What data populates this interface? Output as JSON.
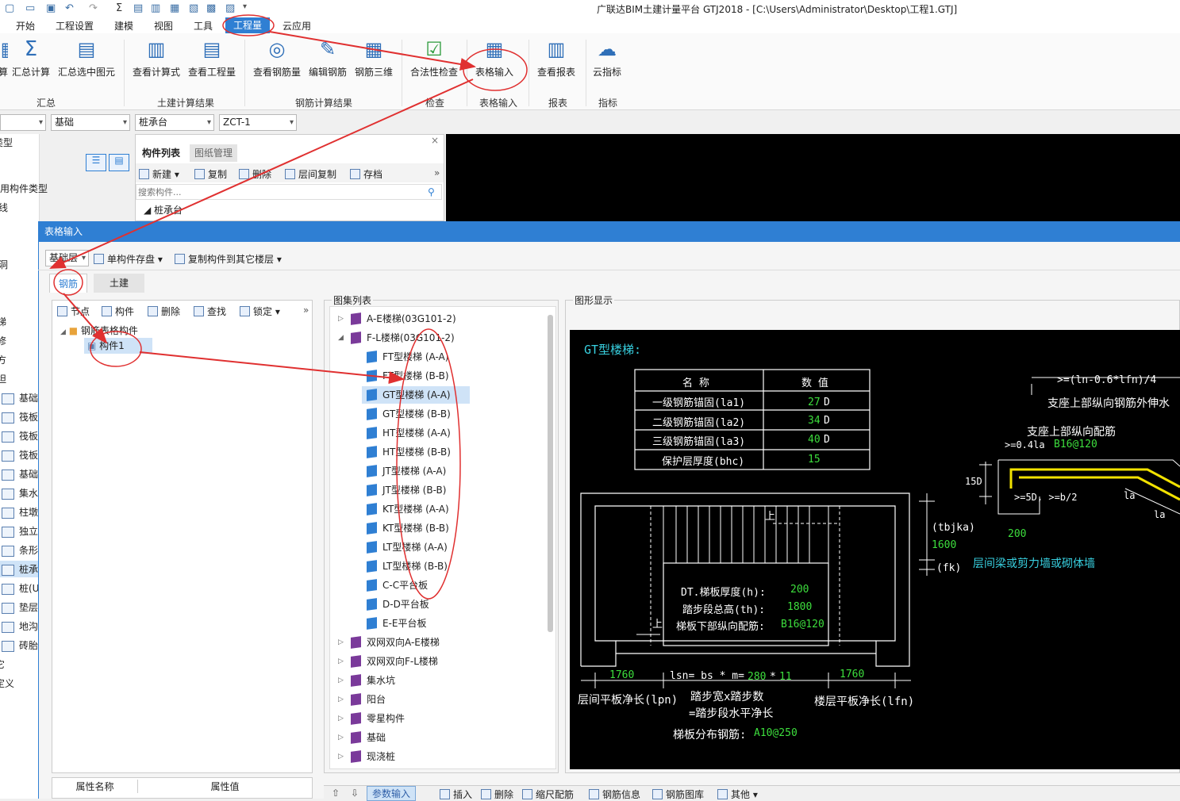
{
  "window": {
    "title": "广联达BIM土建计量平台 GTJ2018 - [C:\\Users\\Administrator\\Desktop\\工程1.GTJ]"
  },
  "menu": [
    "开始",
    "工程设置",
    "建模",
    "视图",
    "工具",
    "工程量",
    "云应用"
  ],
  "ribbon": {
    "buttons": [
      "算",
      "汇总计算",
      "汇总选中图元",
      "查看计算式",
      "查看工程量",
      "查看钢筋量",
      "编辑钢筋",
      "钢筋三维",
      "合法性检查",
      "表格输入",
      "查看报表",
      "云指标"
    ],
    "groups": [
      "汇总",
      "土建计算结果",
      "钢筋计算结果",
      "检查",
      "表格输入",
      "报表",
      "指标"
    ]
  },
  "selectors": [
    "",
    "基础",
    "桩承台",
    "ZCT-1"
  ],
  "left_strip": [
    "类型",
    "用构件类型",
    "线",
    "洞",
    "洞",
    "梯",
    "修",
    "方",
    "坦",
    "基础",
    "筏板",
    "筏板",
    "筏板",
    "基础",
    "集水",
    "柱墩",
    "独立",
    "条形",
    "桩承",
    "桩(U",
    "垫层",
    "地沟",
    "砖胎",
    "它",
    "定义"
  ],
  "component_panel": {
    "tabs": [
      "构件列表",
      "图纸管理"
    ],
    "toolbar": [
      "新建",
      "复制",
      "删除",
      "层间复制",
      "存档"
    ],
    "search_placeholder": "搜索构件...",
    "tree_root": "桩承台"
  },
  "dialog": {
    "title": "表格输入",
    "floor": "基础层",
    "toolbar": [
      "单构件存盘",
      "复制构件到其它楼层"
    ],
    "tabs": [
      "钢筋",
      "土建"
    ],
    "tree_toolbar": [
      "节点",
      "构件",
      "删除",
      "查找",
      "锁定"
    ],
    "tree": {
      "folder": "钢筋表格构件",
      "item": "构件1"
    },
    "prop_headers": [
      "属性名称",
      "属性值"
    ],
    "atlas_title": "图集列表",
    "figure_title": "图形显示",
    "atlas": [
      {
        "label": "A-E楼梯(03G101-2)",
        "type": "group",
        "expanded": false
      },
      {
        "label": "F-L楼梯(03G101-2)",
        "type": "group",
        "expanded": true
      },
      {
        "label": "FT型楼梯 (A-A)",
        "type": "leaf"
      },
      {
        "label": "FT型楼梯 (B-B)",
        "type": "leaf"
      },
      {
        "label": "GT型楼梯 (A-A)",
        "type": "leaf",
        "selected": true
      },
      {
        "label": "GT型楼梯 (B-B)",
        "type": "leaf"
      },
      {
        "label": "HT型楼梯 (A-A)",
        "type": "leaf"
      },
      {
        "label": "HT型楼梯 (B-B)",
        "type": "leaf"
      },
      {
        "label": "JT型楼梯 (A-A)",
        "type": "leaf"
      },
      {
        "label": "JT型楼梯 (B-B)",
        "type": "leaf"
      },
      {
        "label": "KT型楼梯 (A-A)",
        "type": "leaf"
      },
      {
        "label": "KT型楼梯 (B-B)",
        "type": "leaf"
      },
      {
        "label": "LT型楼梯 (A-A)",
        "type": "leaf"
      },
      {
        "label": "LT型楼梯 (B-B)",
        "type": "leaf"
      },
      {
        "label": "C-C平台板",
        "type": "leaf"
      },
      {
        "label": "D-D平台板",
        "type": "leaf"
      },
      {
        "label": "E-E平台板",
        "type": "leaf"
      },
      {
        "label": "双网双向A-E楼梯",
        "type": "group",
        "expanded": false
      },
      {
        "label": "双网双向F-L楼梯",
        "type": "group",
        "expanded": false
      },
      {
        "label": "集水坑",
        "type": "group",
        "expanded": false
      },
      {
        "label": "阳台",
        "type": "group",
        "expanded": false
      },
      {
        "label": "零星构件",
        "type": "group",
        "expanded": false
      },
      {
        "label": "基础",
        "type": "group",
        "expanded": false
      },
      {
        "label": "现浇桩",
        "type": "group",
        "expanded": false
      }
    ],
    "bottom_toolbar": [
      "参数输入",
      "插入",
      "删除",
      "缩尺配筋",
      "钢筋信息",
      "钢筋图库",
      "其他"
    ]
  },
  "figure": {
    "title": "GT型楼梯:",
    "table_headers": [
      "名 称",
      "数 值"
    ],
    "table_rows": [
      {
        "name": "一级钢筋锚固(la1)",
        "value": "27",
        "unit": "D"
      },
      {
        "name": "二级钢筋锚固(la2)",
        "value": "34",
        "unit": "D"
      },
      {
        "name": "三级钢筋锚固(la3)",
        "value": "40",
        "unit": "D"
      },
      {
        "name": "保护层厚度(bhc)",
        "value": "15",
        "unit": ""
      }
    ],
    "labels": {
      "ext": ">=(ln-0.6*lfn)/4",
      "support_out": "支座上部纵向钢筋外伸水",
      "support_top": "支座上部纵向配筋",
      "la_prefix": ">=0.4la",
      "rebar_top": "B16@120",
      "d15": "15D",
      "five_d": ">=5D, >=b/2",
      "la1": "la",
      "la2": "la",
      "v200": "200",
      "tbjka": "(tbjka)",
      "v1600": "1600",
      "fk": "(fk)",
      "wall": "层间梁或剪力墙或砌体墙",
      "up1": "上",
      "up2": "上",
      "dt_label": "DT.梯板厚度(h):",
      "dt_val": "200",
      "th_label": "踏步段总高(th):",
      "th_val": "1800",
      "bot_label": "梯板下部纵向配筋:",
      "bot_val": "B16@120",
      "lpn_val": "1760",
      "lsn": "lsn= bs * m=",
      "bs_val": "280",
      "m_val": "11",
      "lfn_val": "1760",
      "lpn_label": "层间平板净长(lpn)",
      "steps_label": "踏步宽x踏步数",
      "steps_label2": "=踏步段水平净长",
      "lfn_label": "楼层平板净长(lfn)",
      "dist_label": "梯板分布钢筋:",
      "dist_val": "A10@250"
    }
  },
  "colors": {
    "accent": "#2f7fd3",
    "green": "#3dde3d",
    "cyan": "#38d0e0",
    "yellow": "#f2e200",
    "annot_red": "#e03030"
  }
}
